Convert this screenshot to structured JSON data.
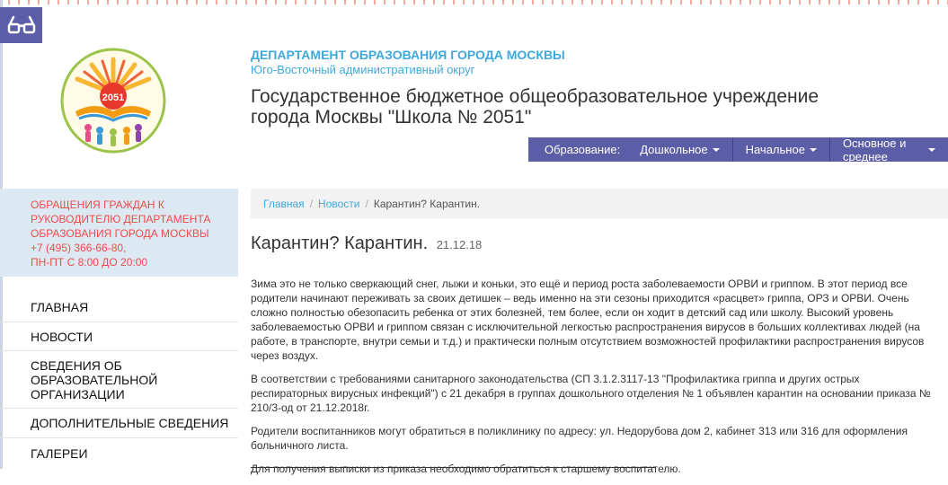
{
  "header": {
    "department": "ДЕПАРТАМЕНТ ОБРАЗОВАНИЯ ГОРОДА МОСКВЫ",
    "okrug": "Юго-Восточный административный округ",
    "school_line1": "Государственное бюджетное общеобразовательное учреждение",
    "school_line2": "города Москвы \"Школа № 2051\"",
    "logo_number": "2051"
  },
  "nav": {
    "label": "Образование:",
    "items": [
      {
        "label": "Дошкольное"
      },
      {
        "label": "Начальное"
      },
      {
        "label": "Основное и среднее"
      }
    ]
  },
  "appeal": {
    "line1": "ОБРАЩЕНИЯ ГРАЖДАН К",
    "line2": "РУКОВОДИТЕЛЮ ДЕПАРТАМЕНТА",
    "line3": "ОБРАЗОВАНИЯ ГОРОДА МОСКВЫ",
    "phone": "+7 (495) 366-66-80,",
    "hours": "ПН-ПТ С 8:00 ДО 20:00"
  },
  "sidebar": {
    "items": [
      {
        "label": "ГЛАВНАЯ"
      },
      {
        "label": "НОВОСТИ"
      },
      {
        "label": "СВЕДЕНИЯ ОБ ОБРАЗОВАТЕЛЬНОЙ ОРГАНИЗАЦИИ"
      },
      {
        "label": "ДОПОЛНИТЕЛЬНЫЕ СВЕДЕНИЯ"
      },
      {
        "label": "ГАЛЕРЕИ"
      }
    ]
  },
  "breadcrumb": {
    "home": "Главная",
    "news": "Новости",
    "current": "Карантин? Карантин.",
    "sep": "/"
  },
  "article": {
    "title": "Карантин? Карантин.",
    "date": "21.12.18",
    "p1": "Зима это не только сверкающий снег, лыжи и коньки, это ещё и период роста заболеваемости ОРВИ и гриппом. В этот период все родители начинают переживать за своих детишек – ведь именно на эти сезоны приходится «расцвет» гриппа, ОРЗ и ОРВИ. Очень сложно полностью обезопасить ребенка от этих болезней, тем более, если он ходит в детский сад или школу. Высокий уровень заболеваемостью ОРВИ и гриппом связан с исключительной легкостью распространения вирусов в больших коллективах людей (на работе, в транспорте, внутри семьи и т.д.) и практически полным отсутствием возможностей профилактики распространения вирусов через воздух.",
    "p2": "В соответствии с требованиями санитарного законодательства (СП 3.1.2.3117-13 \"Профилактика гриппа и других острых респираторных вирусных инфекций\") с 21 декабря в группах дошкольного отделения № 1 объявлен карантин на основании приказа № 210/3-од от 21.12.2018г.",
    "p3": "Родители воспитанников могут обратиться в поликлинику по адресу: ул. Недорубова дом 2, кабинет 313 или 316 для оформления больничного листа.",
    "p4": "Для получения выписки из приказа необходимо обратиться к старшему воспитателю."
  },
  "colors": {
    "brand": "#5b5ea6",
    "link": "#3fa8dc",
    "alert": "#ef4b4b",
    "sidebar_bg": "#dde9f2"
  },
  "icons": {
    "accessibility": "glasses-icon",
    "logo": "school-logo-icon"
  }
}
